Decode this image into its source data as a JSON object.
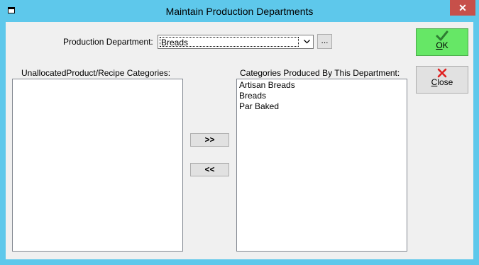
{
  "window": {
    "title": "Maintain Production Departments",
    "close_glyph": "✕"
  },
  "department": {
    "label": "Production Department:",
    "selected": "Breads",
    "browse_label": "..."
  },
  "unallocated": {
    "label": "UnallocatedProduct/Recipe Categories:",
    "items": []
  },
  "produced": {
    "label": "Categories Produced By This Department:",
    "items": [
      "Artisan Breads",
      "Breads",
      "Par Baked"
    ]
  },
  "buttons": {
    "add": ">>",
    "remove": "<<",
    "ok_mnemonic": "O",
    "ok_rest": "K",
    "close_mnemonic": "C",
    "close_rest": "lose"
  },
  "colors": {
    "window_frame": "#5ec8eb",
    "ok_background": "#66e766",
    "close_x": "#c7504a"
  },
  "icons": {
    "ok": "checkmark-icon",
    "close": "red-x-icon"
  }
}
